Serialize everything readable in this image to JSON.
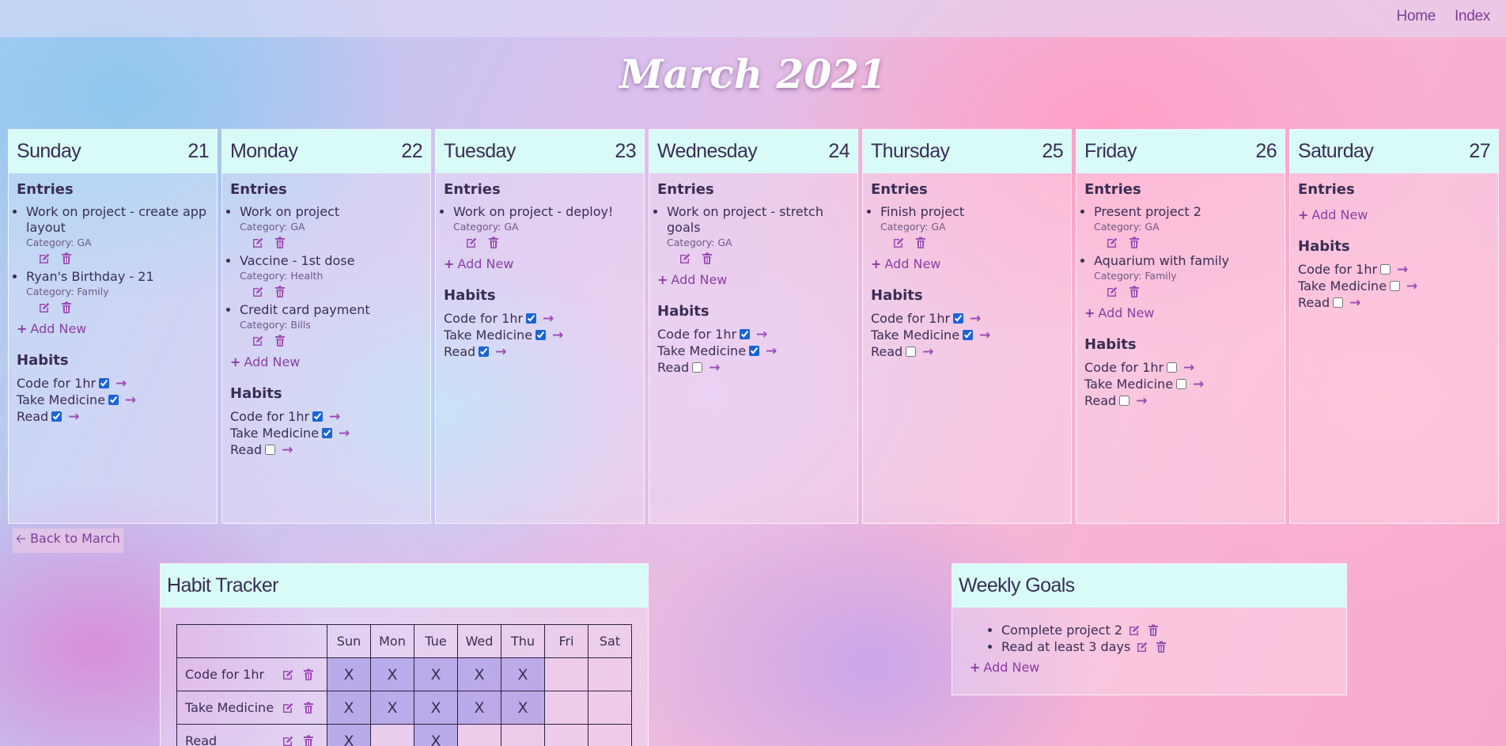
{
  "nav": {
    "links": [
      "Home",
      "Index"
    ]
  },
  "page_title": "March 2021",
  "labels": {
    "entries": "Entries",
    "habits": "Habits",
    "add_new": "Add New",
    "back": "Back to March",
    "tracker_title": "Habit Tracker",
    "goals_title": "Weekly Goals"
  },
  "icons": {
    "edit": "edit-icon",
    "delete": "trash-icon",
    "add": "plus-icon",
    "arrow": "arrow-right-icon",
    "back": "arrow-left-icon"
  },
  "colors": {
    "accent": "#8a3fa5",
    "header_bg": "#d9fbf7",
    "tracker_filled": "#968ce6"
  },
  "days": [
    {
      "name": "Sunday",
      "date": "21",
      "entries": [
        {
          "title": "Work on project - create app layout",
          "category": "Category: GA"
        },
        {
          "title": "Ryan's Birthday - 21",
          "category": "Category: Family"
        }
      ],
      "habits": [
        {
          "name": "Code for 1hr",
          "done": true
        },
        {
          "name": "Take Medicine",
          "done": true
        },
        {
          "name": "Read",
          "done": true
        }
      ]
    },
    {
      "name": "Monday",
      "date": "22",
      "entries": [
        {
          "title": "Work on project",
          "category": "Category: GA"
        },
        {
          "title": "Vaccine - 1st dose",
          "category": "Category: Health"
        },
        {
          "title": "Credit card payment",
          "category": "Category: Bills"
        }
      ],
      "habits": [
        {
          "name": "Code for 1hr",
          "done": true
        },
        {
          "name": "Take Medicine",
          "done": true
        },
        {
          "name": "Read",
          "done": false
        }
      ]
    },
    {
      "name": "Tuesday",
      "date": "23",
      "entries": [
        {
          "title": "Work on project - deploy!",
          "category": "Category: GA"
        }
      ],
      "habits": [
        {
          "name": "Code for 1hr",
          "done": true
        },
        {
          "name": "Take Medicine",
          "done": true
        },
        {
          "name": "Read",
          "done": true
        }
      ]
    },
    {
      "name": "Wednesday",
      "date": "24",
      "entries": [
        {
          "title": "Work on project - stretch goals",
          "category": "Category: GA"
        }
      ],
      "habits": [
        {
          "name": "Code for 1hr",
          "done": true
        },
        {
          "name": "Take Medicine",
          "done": true
        },
        {
          "name": "Read",
          "done": false
        }
      ]
    },
    {
      "name": "Thursday",
      "date": "25",
      "entries": [
        {
          "title": "Finish project",
          "category": "Category: GA"
        }
      ],
      "habits": [
        {
          "name": "Code for 1hr",
          "done": true
        },
        {
          "name": "Take Medicine",
          "done": true
        },
        {
          "name": "Read",
          "done": false
        }
      ]
    },
    {
      "name": "Friday",
      "date": "26",
      "entries": [
        {
          "title": "Present project 2",
          "category": "Category: GA"
        },
        {
          "title": "Aquarium with family",
          "category": "Category: Family"
        }
      ],
      "habits": [
        {
          "name": "Code for 1hr",
          "done": false
        },
        {
          "name": "Take Medicine",
          "done": false
        },
        {
          "name": "Read",
          "done": false
        }
      ]
    },
    {
      "name": "Saturday",
      "date": "27",
      "entries": [],
      "habits": [
        {
          "name": "Code for 1hr",
          "done": false
        },
        {
          "name": "Take Medicine",
          "done": false
        },
        {
          "name": "Read",
          "done": false
        }
      ]
    }
  ],
  "tracker": {
    "columns": [
      "Sun",
      "Mon",
      "Tue",
      "Wed",
      "Thu",
      "Fri",
      "Sat"
    ],
    "rows": [
      {
        "habit": "Code for 1hr",
        "marks": [
          "X",
          "X",
          "X",
          "X",
          "X",
          "",
          ""
        ]
      },
      {
        "habit": "Take Medicine",
        "marks": [
          "X",
          "X",
          "X",
          "X",
          "X",
          "",
          ""
        ]
      },
      {
        "habit": "Read",
        "marks": [
          "X",
          "",
          "X",
          "",
          "",
          "",
          ""
        ]
      }
    ]
  },
  "goals": [
    "Complete project 2",
    "Read at least 3 days"
  ]
}
